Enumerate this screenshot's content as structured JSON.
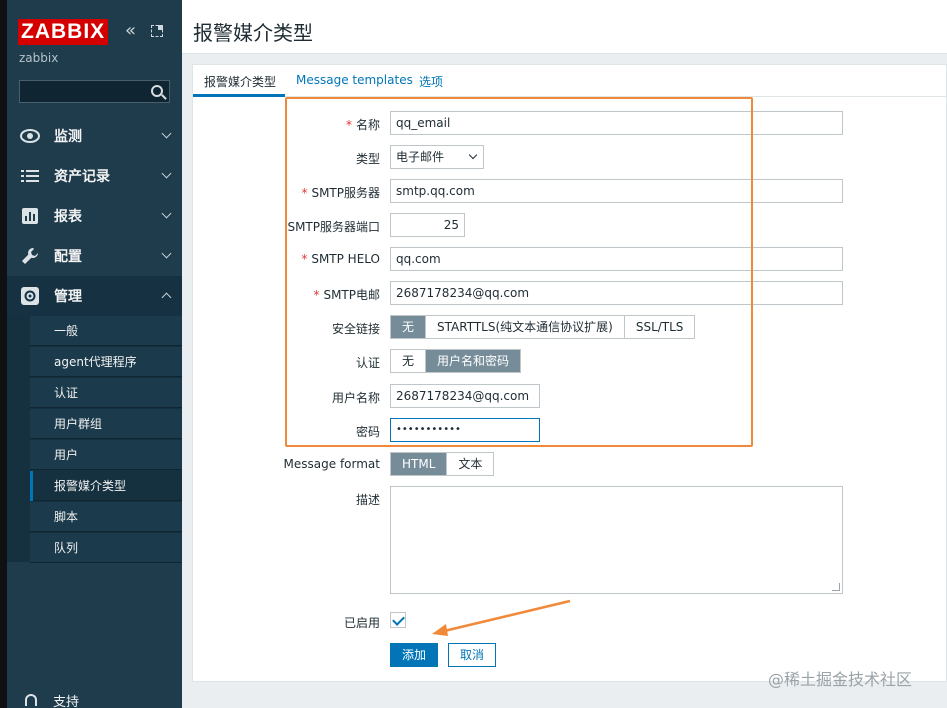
{
  "sidebar": {
    "logo": "ZABBIX",
    "server_name": "zabbix",
    "search_placeholder": "",
    "nav": [
      {
        "label": "监测",
        "icon": "eye-icon"
      },
      {
        "label": "资产记录",
        "icon": "list-icon"
      },
      {
        "label": "报表",
        "icon": "bar-chart-icon"
      },
      {
        "label": "配置",
        "icon": "wrench-icon"
      },
      {
        "label": "管理",
        "icon": "gear-icon"
      }
    ],
    "submenu": [
      {
        "label": "一般"
      },
      {
        "label": "agent代理程序"
      },
      {
        "label": "认证"
      },
      {
        "label": "用户群组"
      },
      {
        "label": "用户"
      },
      {
        "label": "报警媒介类型"
      },
      {
        "label": "脚本"
      },
      {
        "label": "队列"
      }
    ],
    "support": "支持"
  },
  "header": {
    "title": "报警媒介类型"
  },
  "tabs": [
    {
      "label": "报警媒介类型"
    },
    {
      "label": "Message templates"
    },
    {
      "label": "选项"
    }
  ],
  "form": {
    "name_label": "名称",
    "name_value": "qq_email",
    "type_label": "类型",
    "type_value": "电子邮件",
    "smtp_server_label": "SMTP服务器",
    "smtp_server_value": "smtp.qq.com",
    "smtp_port_label": "SMTP服务器端口",
    "smtp_port_value": "25",
    "smtp_helo_label": "SMTP HELO",
    "smtp_helo_value": "qq.com",
    "smtp_email_label": "SMTP电邮",
    "smtp_email_value": "2687178234@qq.com",
    "security_label": "安全链接",
    "security_options": [
      "无",
      "STARTTLS(纯文本通信协议扩展)",
      "SSL/TLS"
    ],
    "auth_label": "认证",
    "auth_options": [
      "无",
      "用户名和密码"
    ],
    "username_label": "用户名称",
    "username_value": "2687178234@qq.com",
    "password_label": "密码",
    "password_value": "•••••••••••",
    "message_format_label": "Message format",
    "message_format_options": [
      "HTML",
      "文本"
    ],
    "description_label": "描述",
    "enabled_label": "已启用",
    "add_button": "添加",
    "cancel_button": "取消"
  },
  "watermark": "@稀土掘金技术社区",
  "colors": {
    "accent": "#0275b8",
    "logo_red": "#d40000",
    "sidebar": "#1f3c4c",
    "annotation": "#f08a3a"
  }
}
